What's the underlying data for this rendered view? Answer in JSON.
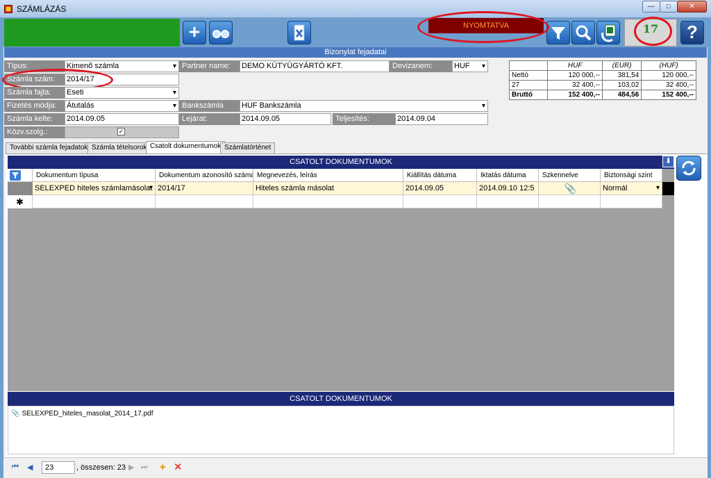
{
  "window": {
    "title": "SZÁMLÁZÁS"
  },
  "toolbar": {
    "status_printed": "NYOMTATVA",
    "counter": "17",
    "help_label": "?"
  },
  "header": {
    "section_title": "Bizonylat fejadatai",
    "type_label": "Típus:",
    "type_value": "Kimenő számla",
    "invoice_no_label": "Számla szám:",
    "invoice_no_value": "2014/17",
    "invoice_kind_label": "Számla fajta:",
    "invoice_kind_value": "Eseti",
    "payment_label": "Fizetés módja:",
    "payment_value": "Átutalás",
    "issue_date_label": "Számla kelte:",
    "issue_date_value": "2014.09.05",
    "utility_label": "Közv.szolg.:",
    "partner_label": "Partner name:",
    "partner_value": "DEMO KÜTYÜGYÁRTÓ KFT.",
    "currency_label": "Devizanem:",
    "currency_value": "HUF",
    "bank_label": "Bankszámla",
    "bank_value": "HUF Bankszámla",
    "due_label": "Lejárat:",
    "due_value": "2014.09.05",
    "perf_label": "Teljesítés:",
    "perf_value": "2014.09.04"
  },
  "totals": {
    "headers": [
      "",
      "HUF",
      "(EUR)",
      "(HUF)"
    ],
    "rows": [
      [
        "Nettó",
        "120 000,--",
        "381,54",
        "120 000,--"
      ],
      [
        "27",
        "32 400,--",
        "103,02",
        "32 400,--"
      ],
      [
        "Bruttó",
        "152 400,--",
        "484,56",
        "152 400,--"
      ]
    ]
  },
  "tabs": [
    {
      "label": "További számla fejadatok"
    },
    {
      "label": "Számla tételsorok"
    },
    {
      "label": "Csatolt dokumentumok"
    },
    {
      "label": "Számlatörténet"
    }
  ],
  "grid": {
    "title": "CSATOLT DOKUMENTUMOK",
    "columns": [
      "Dokumentum típusa",
      "Dokumentum azonosító száma",
      "Megnevezés, leírás",
      "Kiállítás dátuma",
      "Iktatás dátuma",
      "Szkennelve",
      "Biztonsági szint"
    ],
    "rows": [
      [
        "SELEXPED hiteles számlamásolat",
        "2014/17",
        "Hiteles számla másolat",
        "2014.09.05",
        "2014.09.10 12:5",
        "",
        "Normál"
      ]
    ],
    "new_row_marker": "✱"
  },
  "attachments": {
    "title": "CSATOLT DOKUMENTUMOK",
    "items": [
      {
        "name": "SELEXPED_hiteles_masolat_2014_17.pdf"
      }
    ]
  },
  "navigator": {
    "position": "23",
    "total": ", összesen: 23"
  },
  "colors": {
    "status_green": "#1e9a1e",
    "printed_bg": "#800000",
    "printed_text": "#ff9a3c",
    "section_blue": "#4a78c0",
    "grid_title_navy": "#1c2878",
    "highlight_red": "#e0141e"
  }
}
